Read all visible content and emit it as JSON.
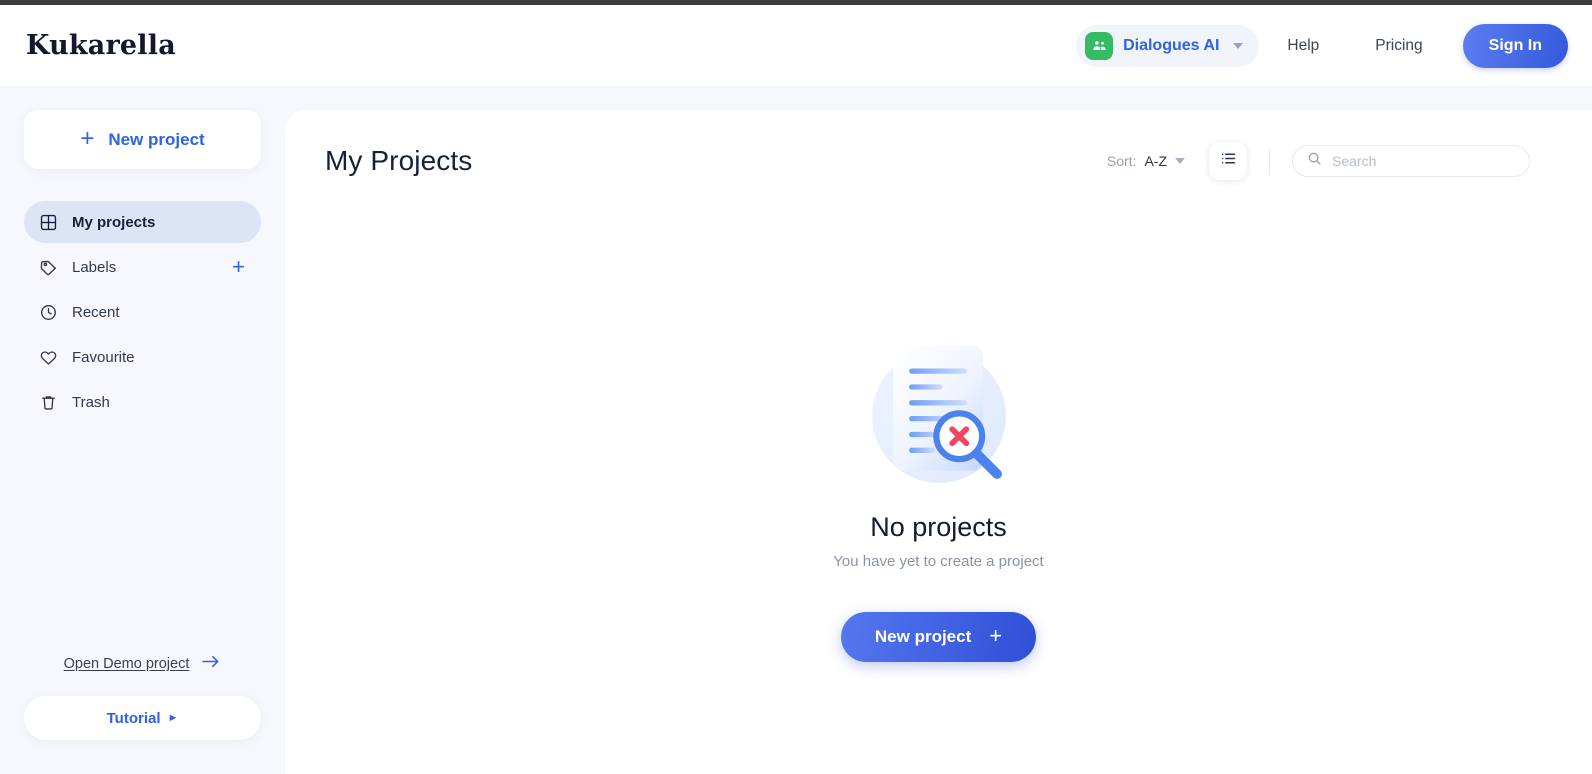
{
  "brand": {
    "logo": "Kukarella"
  },
  "header": {
    "workspace": {
      "label": "Dialogues AI",
      "icon": "people-group-icon",
      "caret": "chevron-down-icon",
      "icon_color": "#34bb63"
    },
    "links": [
      {
        "label": "Help",
        "name": "help"
      },
      {
        "label": "Pricing",
        "name": "pricing"
      }
    ],
    "signin_label": "Sign In",
    "accent_color": "#2f62e8"
  },
  "sidebar": {
    "new_project_label": "New project",
    "new_project_icon": "plus-icon",
    "items": [
      {
        "label": "My projects",
        "icon": "grid-icon",
        "active": true,
        "add": false
      },
      {
        "label": "Labels",
        "icon": "tag-icon",
        "active": false,
        "add": true,
        "add_icon": "plus-icon"
      },
      {
        "label": "Recent",
        "icon": "clock-icon",
        "active": false,
        "add": false
      },
      {
        "label": "Favourite",
        "icon": "heart-icon",
        "active": false,
        "add": false
      },
      {
        "label": "Trash",
        "icon": "trash-icon",
        "active": false,
        "add": false
      }
    ],
    "demo_link": {
      "label": "Open Demo project",
      "icon": "arrow-right-icon"
    },
    "tutorial": {
      "label": "Tutorial",
      "icon": "play-icon"
    }
  },
  "main": {
    "title": "My Projects",
    "sort": {
      "prefix": "Sort:",
      "value": "A-Z",
      "caret": "chevron-down-icon"
    },
    "view_toggle_icon": "list-view-icon",
    "search": {
      "placeholder": "Search",
      "value": "",
      "icon": "search-icon"
    },
    "empty": {
      "illustration": "document-not-found-icon",
      "title": "No projects",
      "subtitle": "You have yet to create a project",
      "button_label": "New project",
      "button_icon": "plus-icon"
    }
  }
}
